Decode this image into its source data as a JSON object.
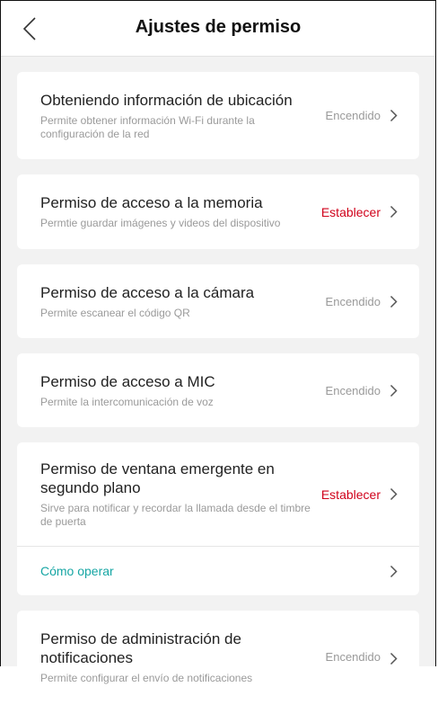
{
  "header": {
    "title": "Ajustes de permiso",
    "back_icon": "chevron-left-icon"
  },
  "permissions": [
    {
      "title": "Obteniendo información de ubicación",
      "description": "Permite obtener información Wi-Fi durante la configuración de la red",
      "status": "Encendido"
    },
    {
      "title": "Permiso de acceso a la memoria",
      "description": "Permtie guardar imágenes y videos del dispositivo",
      "status": "Establecer"
    },
    {
      "title": "Permiso de acceso a la cámara",
      "description": "Permite escanear el código QR",
      "status": "Encendido"
    },
    {
      "title": "Permiso de acceso a MIC",
      "description": "Permite la intercomunicación de voz",
      "status": "Encendido"
    },
    {
      "title": "Permiso de ventana emergente en segundo plano",
      "description": "Sirve para notificar y recordar la llamada desde el timbre de puerta",
      "status": "Establecer",
      "howto": "Cómo operar"
    },
    {
      "title": "Permiso de administración de notificaciones",
      "description": "Permite configurar el envío de notificaciones",
      "status": "Encendido"
    }
  ],
  "colors": {
    "warning": "#d0021b",
    "link": "#17a6a4",
    "muted": "#9a9a9a",
    "background": "#f2f2f2"
  }
}
